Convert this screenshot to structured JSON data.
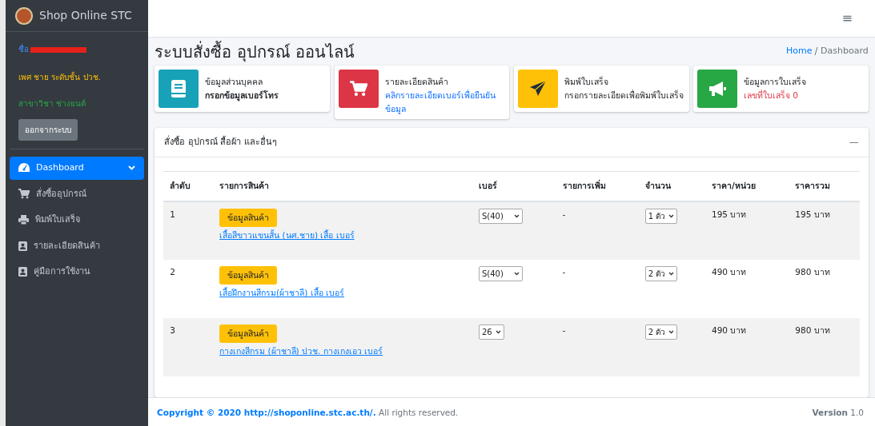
{
  "brand": {
    "title": "Shop Online STC"
  },
  "user": {
    "name_label": "ชื่อ",
    "info": "เพศ ชาย ระดับชั้น ปวช.",
    "major": "สาขาวิชา ช่างยนต์",
    "logout": "ออกจากระบบ"
  },
  "sidebar": {
    "items": [
      {
        "label": "Dashboard",
        "selected": true,
        "expanded": true
      },
      {
        "label": "สั่งซื้ออุปกรณ์",
        "selected": false
      },
      {
        "label": "พิมพ์ใบเสร็จ",
        "selected": false
      },
      {
        "label": "รายละเอียดสินค้า",
        "selected": false
      },
      {
        "label": "คู่มือการใช้งาน",
        "selected": false
      }
    ]
  },
  "topbar": {
    "menu_icon": "≡"
  },
  "page": {
    "title": "ระบบสั่งซื้อ อุปกรณ์ ออนไลน์",
    "breadcrumb": [
      "Home",
      "Dashboard"
    ]
  },
  "info_boxes": [
    {
      "title": "ข้อมูลส่วนบุคคล",
      "text": "กรอกข้อมูลเบอร์โทร",
      "color": "#17a2b8"
    },
    {
      "title": "รายละเอียดสินค้า",
      "text": "คลิกรายละเอียดเบอร์เพื่อยืนยันข้อมูล",
      "color": "#dc3545"
    },
    {
      "title": "พิมพ์ใบเสร็จ",
      "text": "กรอกรายละเอียดเพื่อพิมพ์ใบเสร็จ",
      "color": "#ffc107"
    },
    {
      "title": "ข้อมูลการใบเสร็จ",
      "text": "เลขที่ใบเสร็จ 0",
      "color": "#28a745"
    }
  ],
  "order_card": {
    "title": "สั่งซื้อ อุปกรณ์ สื้อผ้า และอื่นๆ",
    "collapse": "—",
    "table": {
      "columns": [
        "ลำดับ",
        "รายการสินค้า",
        "เบอร์",
        "รายการเพิ่ม",
        "จำนวน",
        "ราคา/หน่วย",
        "ราคารวม"
      ],
      "rows": [
        {
          "no": "1",
          "button": "ข้อมูลสินค้า",
          "product": "เสื้อสีขาวแขนสั้น (นศ.ชาย) เสื้อ เบอร์",
          "size": "S(40)",
          "extra": "-",
          "qty": "1 ตัว",
          "unit_price": "195 บาท",
          "total": "195 บาท"
        },
        {
          "no": "2",
          "button": "ข้อมูลสินค้า",
          "product": "เสื้อฝึกงานสีกรม(ผ้าชาลี) เสื้อ เบอร์",
          "size": "S(40)",
          "extra": "-",
          "qty": "2 ตัว",
          "unit_price": "490 บาท",
          "total": "980 บาท"
        },
        {
          "no": "3",
          "button": "ข้อมูลสินค้า",
          "product": "กางเกงสีกรม (ผ้าชาลี) ปวช. กางเกงเอว เบอร์",
          "size": "26",
          "extra": "-",
          "qty": "2 ตัว",
          "unit_price": "490 บาท",
          "total": "980 บาท"
        }
      ]
    }
  },
  "footer": {
    "copyright": "**Copyright © 2020 http://shoponline.stc.ac.th/.** All rights reserved.",
    "version": "**Version** 1.0"
  }
}
